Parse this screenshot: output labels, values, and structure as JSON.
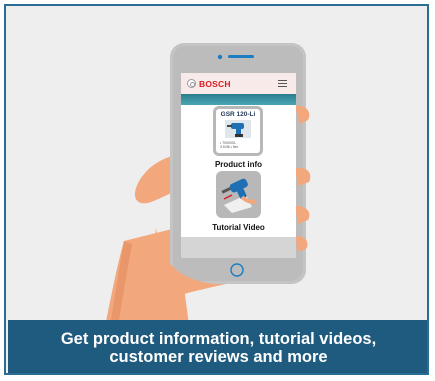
{
  "app": {
    "brand_name": "BOSCH"
  },
  "products": [
    {
      "model": "GSR 120-Li",
      "spec_line_1": "• 70000XL",
      "spec_line_2": "3.5/36 • Nm",
      "label": "Product info"
    },
    {
      "label": "Tutorial Video"
    }
  ],
  "caption": {
    "line_1": "Get product information, tutorial videos,",
    "line_2": "customer reviews and more"
  },
  "colors": {
    "accent_teal": "#3a90a0",
    "brand_red": "#d71b21",
    "caption_bg": "#1f5b7e",
    "phone_body": "#c4c4c4"
  },
  "icons": {
    "brand": "bosch-logo-icon",
    "menu": "hamburger-menu-icon",
    "home": "home-button-icon"
  }
}
